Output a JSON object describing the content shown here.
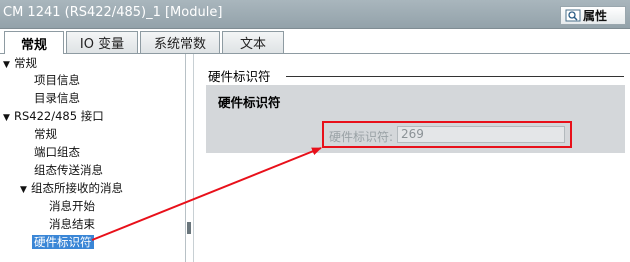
{
  "window": {
    "title": "CM 1241 (RS422/485)_1 [Module]",
    "properties_tab": "属性",
    "properties_icon": "properties-icon"
  },
  "tabs": [
    {
      "label": "常规",
      "active": true
    },
    {
      "label": "IO 变量",
      "active": false
    },
    {
      "label": "系统常数",
      "active": false
    },
    {
      "label": "文本",
      "active": false
    }
  ],
  "tree": [
    {
      "label": "常规",
      "expand": "▼"
    },
    {
      "label": "项目信息"
    },
    {
      "label": "目录信息"
    },
    {
      "label": "RS422/485 接口",
      "expand": "▼"
    },
    {
      "label": "常规"
    },
    {
      "label": "端口组态"
    },
    {
      "label": "组态传送消息"
    },
    {
      "label": "组态所接收的消息",
      "expand": "▼"
    },
    {
      "label": "消息开始"
    },
    {
      "label": "消息结束"
    },
    {
      "label": "硬件标识符",
      "selected": true
    }
  ],
  "content": {
    "section_title": "硬件标识符",
    "panel_header": "硬件标识符",
    "field_label": "硬件标识符:",
    "field_value": "269"
  },
  "colors": {
    "highlight": "#e8101a",
    "selection": "#3a86d6",
    "panel": "#d4d7da"
  }
}
